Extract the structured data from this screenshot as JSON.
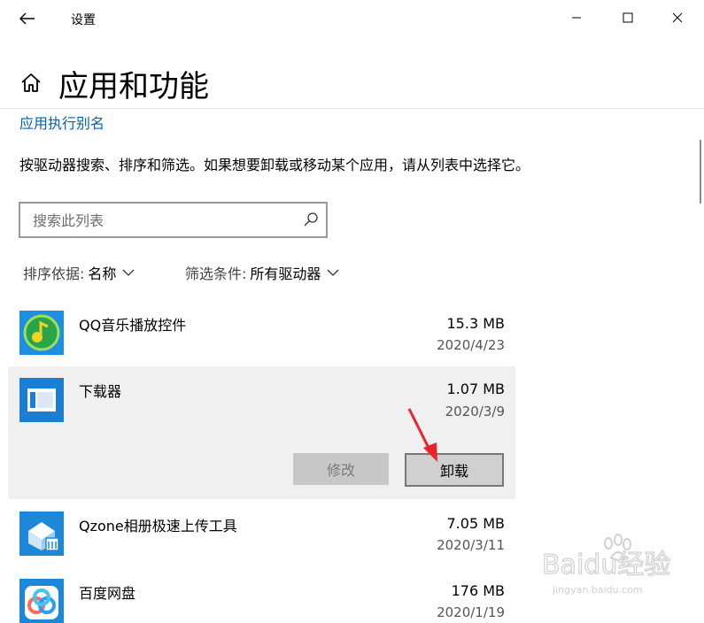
{
  "window": {
    "title": "设置",
    "controls": [
      "minimize-icon",
      "maximize-icon",
      "close-icon"
    ]
  },
  "header": {
    "page_title": "应用和功能",
    "alias_link": "应用执行别名"
  },
  "description": "按驱动器搜索、排序和筛选。如果想要卸载或移动某个应用，请从列表中选择它。",
  "search": {
    "placeholder": "搜索此列表",
    "value": ""
  },
  "sort": {
    "label": "排序依据: ",
    "value": "名称"
  },
  "filter": {
    "label": "筛选条件: ",
    "value": "所有驱动器"
  },
  "apps": [
    {
      "name": "QQ音乐播放控件",
      "size": "15.3 MB",
      "date": "2020/4/23"
    },
    {
      "name": "下载器",
      "size": "1.07 MB",
      "date": "2020/3/9"
    },
    {
      "name": "Qzone相册极速上传工具",
      "size": "7.05 MB",
      "date": "2020/3/11"
    },
    {
      "name": "百度网盘",
      "size": "176 MB",
      "date": "2020/1/19"
    }
  ],
  "actions": {
    "modify": "修改",
    "uninstall": "卸载"
  },
  "watermark": {
    "text": "Baidu经验",
    "url": "jingyan.baidu.com"
  },
  "colors": {
    "accent": "#0063b1",
    "selected_row": "#f0f0f0",
    "arrow": "#e8232a"
  }
}
